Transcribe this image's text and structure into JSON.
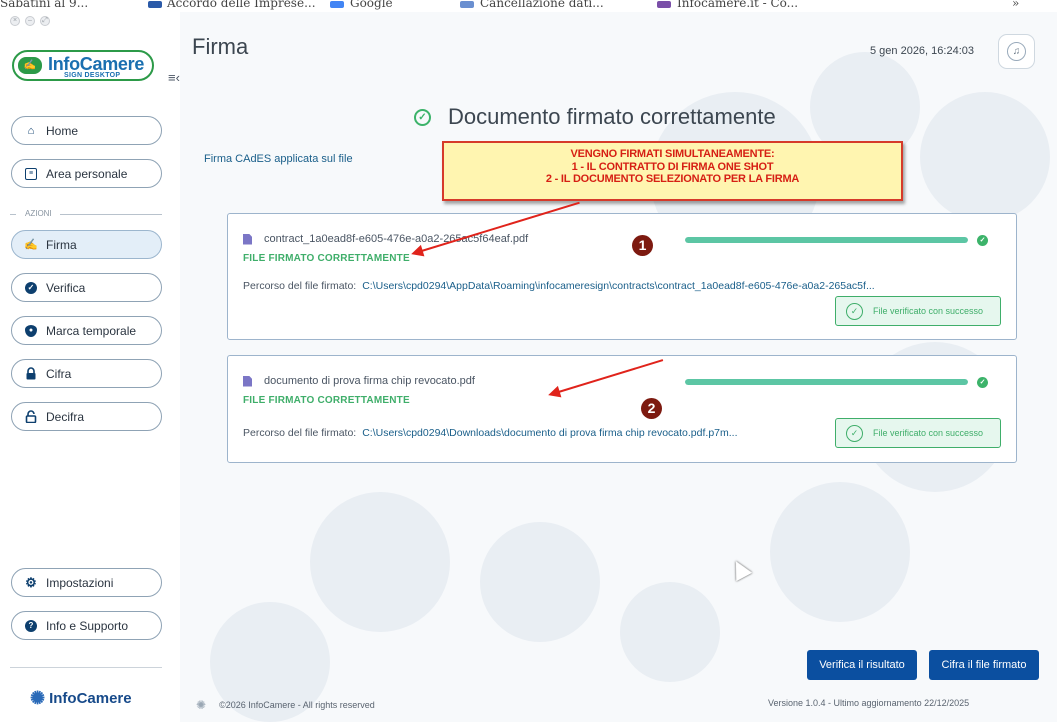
{
  "browser_bar": {
    "items": [
      "Sabatini al 9...",
      "Accordo delle Imprese...",
      "Google",
      "Cancellazione dati...",
      "Infocamere.it - Co..."
    ],
    "more": "»"
  },
  "app": {
    "logo_brand": "InfoCamere",
    "logo_sub": "SIGN DESKTOP",
    "collapse_icon": "≡‹",
    "footer_brand": "InfoCamere"
  },
  "sidebar": {
    "items": [
      {
        "label": "Home",
        "icon": "home-icon"
      },
      {
        "label": "Area personale",
        "icon": "id-card-icon"
      }
    ],
    "section_label": "AZIONI",
    "actions": [
      {
        "label": "Firma",
        "icon": "signature-icon",
        "active": true
      },
      {
        "label": "Verifica",
        "icon": "verified-icon"
      },
      {
        "label": "Marca temporale",
        "icon": "shield-icon"
      },
      {
        "label": "Cifra",
        "icon": "lock-icon"
      },
      {
        "label": "Decifra",
        "icon": "unlock-icon"
      }
    ],
    "bottom": [
      {
        "label": "Impostazioni",
        "icon": "gear-icon"
      },
      {
        "label": "Info e Supporto",
        "icon": "help-icon"
      }
    ]
  },
  "header": {
    "title": "Firma",
    "datetime": "5 gen 2026, 16:24:03"
  },
  "main": {
    "headline": "Documento firmato correttamente",
    "subtitle": "Firma CAdES applicata sul file",
    "path_label": "Percorso del file firmato:",
    "status_ok": "FILE FIRMATO CORRETTAMENTE",
    "verified_label": "File verificato con successo",
    "files": [
      {
        "name": "contract_1a0ead8f-e605-476e-a0a2-265ac5f64eaf.pdf",
        "path": "C:\\Users\\cpd0294\\AppData\\Roaming\\infocameresign\\contracts\\contract_1a0ead8f-e605-476e-a0a2-265ac5f...",
        "progress": 1.0
      },
      {
        "name": "documento di prova firma chip revocato.pdf",
        "path": "C:\\Users\\cpd0294\\Downloads\\documento di prova firma chip revocato.pdf.p7m...",
        "progress": 1.0
      }
    ]
  },
  "annotation": {
    "lines": [
      "VENGNO FIRMATI SIMULTANEAMENTE:",
      "1 - IL CONTRATTO DI FIRMA ONE SHOT",
      "2 - IL DOCUMENTO SELEZIONATO PER LA FIRMA"
    ],
    "markers": [
      "1",
      "2"
    ],
    "color": "#d61f14"
  },
  "actions": {
    "verify_label": "Verifica il risultato",
    "encrypt_label": "Cifra il file firmato"
  },
  "footer": {
    "copyright": "©2026 InfoCamere - All rights reserved",
    "version": "Versione 1.0.4 - Ultimo aggiornamento 22/12/2025"
  },
  "colors": {
    "primary": "#0b4fa0",
    "success": "#3fae6a",
    "brand_green": "#2c9a48"
  }
}
